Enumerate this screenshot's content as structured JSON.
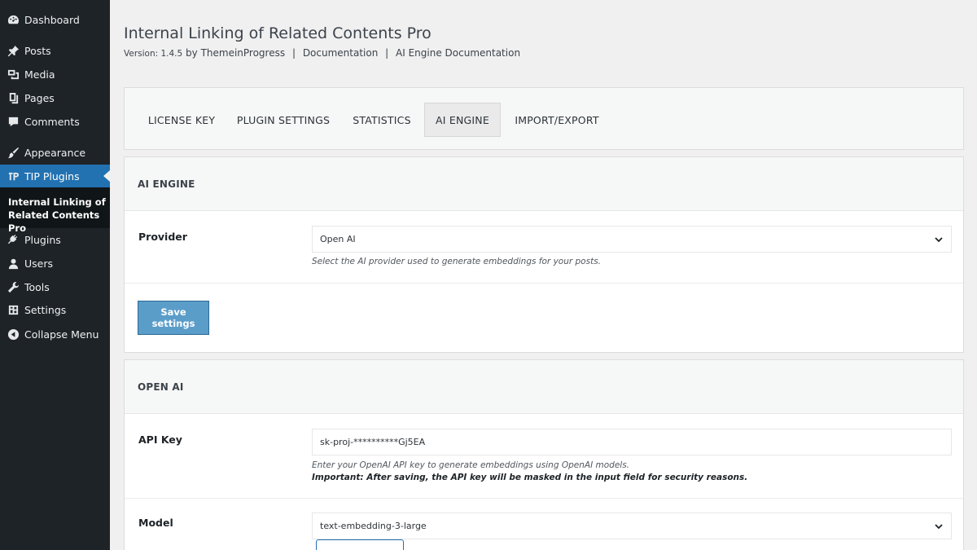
{
  "sidebar": {
    "items": [
      {
        "label": "Dashboard",
        "icon": "dashboard-icon"
      },
      {
        "label": "Posts",
        "icon": "pin-icon"
      },
      {
        "label": "Media",
        "icon": "media-icon"
      },
      {
        "label": "Pages",
        "icon": "pages-icon"
      },
      {
        "label": "Comments",
        "icon": "comment-icon"
      },
      {
        "label": "Appearance",
        "icon": "brush-icon"
      },
      {
        "label": "TIP Plugins",
        "icon": "tip-plugin-icon"
      },
      {
        "label": "Plugins",
        "icon": "plug-icon"
      },
      {
        "label": "Users",
        "icon": "user-icon"
      },
      {
        "label": "Tools",
        "icon": "wrench-icon"
      },
      {
        "label": "Settings",
        "icon": "settings-icon"
      },
      {
        "label": "Collapse Menu",
        "icon": "collapse-icon"
      }
    ],
    "submenu": {
      "label": "Internal Linking of Related Contents Pro"
    },
    "active_color": "#2271b1"
  },
  "header": {
    "title": "Internal Linking of Related Contents Pro",
    "version": "Version: 1.4.5",
    "author": "by ThemeinProgress",
    "sep": "|",
    "doc_link": "Documentation",
    "ai_doc_link": "AI Engine Documentation"
  },
  "tabs": [
    {
      "label": "LICENSE KEY"
    },
    {
      "label": "PLUGIN SETTINGS"
    },
    {
      "label": "STATISTICS"
    },
    {
      "label": "AI ENGINE"
    },
    {
      "label": "IMPORT/EXPORT"
    }
  ],
  "ai_engine": {
    "heading": "AI ENGINE",
    "provider_label": "Provider",
    "provider_value": "Open AI",
    "provider_hint": "Select the AI provider used to generate embeddings for your posts.",
    "save_label": "Save settings"
  },
  "open_ai": {
    "heading": "OPEN AI",
    "api_key_label": "API Key",
    "api_key_value": "sk-proj-**********Gj5EA",
    "api_key_hint": "Enter your OpenAI API key to generate embeddings using OpenAI models.",
    "api_key_important": "Important: After saving, the API key will be masked in the input field for security reasons.",
    "model_label": "Model",
    "model_value": "text-embedding-3-large"
  }
}
